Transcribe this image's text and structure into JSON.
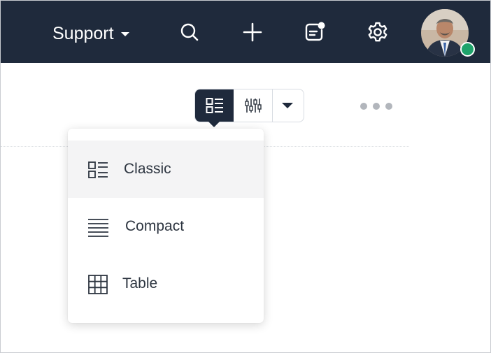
{
  "header": {
    "department": "Support",
    "icons": [
      "search-icon",
      "plus-icon",
      "notes-icon",
      "gear-icon"
    ],
    "notification_dot": true,
    "user_status": "online",
    "colors": {
      "bar": "#1f2a3c",
      "online": "#1fa36b"
    }
  },
  "toolbar": {
    "view_modes": [
      "classic-view-icon",
      "kanban-view-icon",
      "caret-down-icon"
    ],
    "active_view": "classic",
    "more_icon": "more-horizontal-icon"
  },
  "view_menu": {
    "items": [
      {
        "label": "Classic",
        "icon": "classic-list-icon",
        "highlighted": true
      },
      {
        "label": "Compact",
        "icon": "compact-lines-icon",
        "highlighted": false
      },
      {
        "label": "Table",
        "icon": "table-grid-icon",
        "highlighted": false
      }
    ]
  }
}
